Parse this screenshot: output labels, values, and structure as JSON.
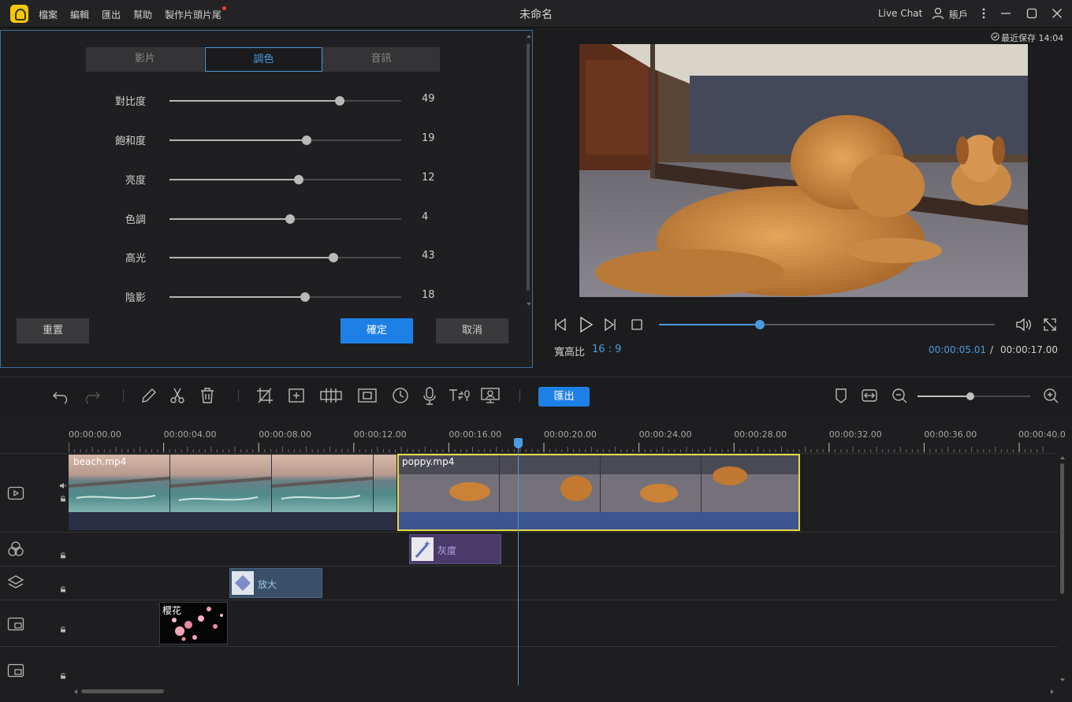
{
  "app": {
    "title": "未命名",
    "menu": [
      "檔案",
      "編輯",
      "匯出",
      "幫助",
      "製作片頭片尾"
    ],
    "live_chat": "Live Chat",
    "account": "賬戶"
  },
  "adjust_panel": {
    "tabs": [
      {
        "label": "影片",
        "active": false
      },
      {
        "label": "調色",
        "active": true
      },
      {
        "label": "音訊",
        "active": false
      }
    ],
    "sliders": [
      {
        "label": "對比度",
        "value": 49,
        "fraction": 0.735
      },
      {
        "label": "飽和度",
        "value": 19,
        "fraction": 0.592
      },
      {
        "label": "亮度",
        "value": 12,
        "fraction": 0.558
      },
      {
        "label": "色調",
        "value": 4,
        "fraction": 0.52
      },
      {
        "label": "高光",
        "value": 43,
        "fraction": 0.707
      },
      {
        "label": "陰影",
        "value": 18,
        "fraction": 0.585
      }
    ],
    "reset_label": "重置",
    "ok_label": "確定",
    "cancel_label": "取消"
  },
  "preview": {
    "last_saved": "最近保存 14:04",
    "aspect_label": "寬高比",
    "aspect_value": "16 : 9",
    "current_time": "00:00:05.01",
    "separator": "/",
    "total_time": "00:00:17.00",
    "progress_fraction": 0.3
  },
  "toolbar": {
    "export_label": "匯出",
    "zoom_fraction": 0.47
  },
  "timeline": {
    "ticks": [
      "00:00:00.00",
      "00:00:04.00",
      "00:00:08.00",
      "00:00:12.00",
      "00:00:16.00",
      "00:00:20.00",
      "00:00:24.00",
      "00:00:28.00",
      "00:00:32.00",
      "00:00:36.00",
      "00:00:40.0"
    ],
    "playhead_seconds": 18.9,
    "video_clips": [
      {
        "name": "beach.mp4"
      },
      {
        "name": "poppy.mp4"
      }
    ],
    "filter_clip": "灰度",
    "overlay_clip": "放大",
    "pip_clip": "樱花"
  },
  "colors": {
    "accent": "#1e80e6",
    "selection": "#e6d84a",
    "filter_clip": "#4a3a6a",
    "overlay_clip": "#3a5068"
  }
}
